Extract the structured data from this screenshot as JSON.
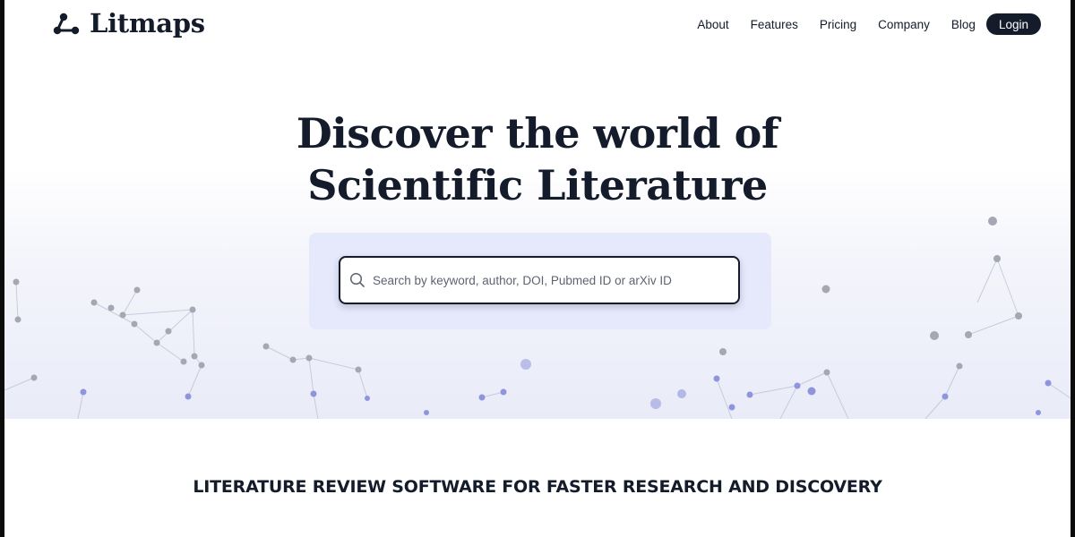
{
  "brand": {
    "name": "Litmaps",
    "icon": "network-nodes-icon"
  },
  "nav": {
    "links": [
      "About",
      "Features",
      "Pricing",
      "Company",
      "Blog"
    ],
    "login_label": "Login"
  },
  "hero": {
    "headline_line1": "Discover the world of",
    "headline_line2": "Scientific Literature",
    "search": {
      "placeholder": "Search by keyword, author, DOI, Pubmed ID or arXiv ID",
      "value": "",
      "icon": "search-icon"
    },
    "decoration": "network-graph"
  },
  "section": {
    "tagline": "LITERATURE REVIEW SOFTWARE FOR FASTER RESEARCH AND DISCOVERY"
  },
  "colors": {
    "ink": "#141c2b",
    "search_panel": "#e6e9fb",
    "node_gray": "#a5a7b3",
    "node_blue": "#8f95dc"
  }
}
